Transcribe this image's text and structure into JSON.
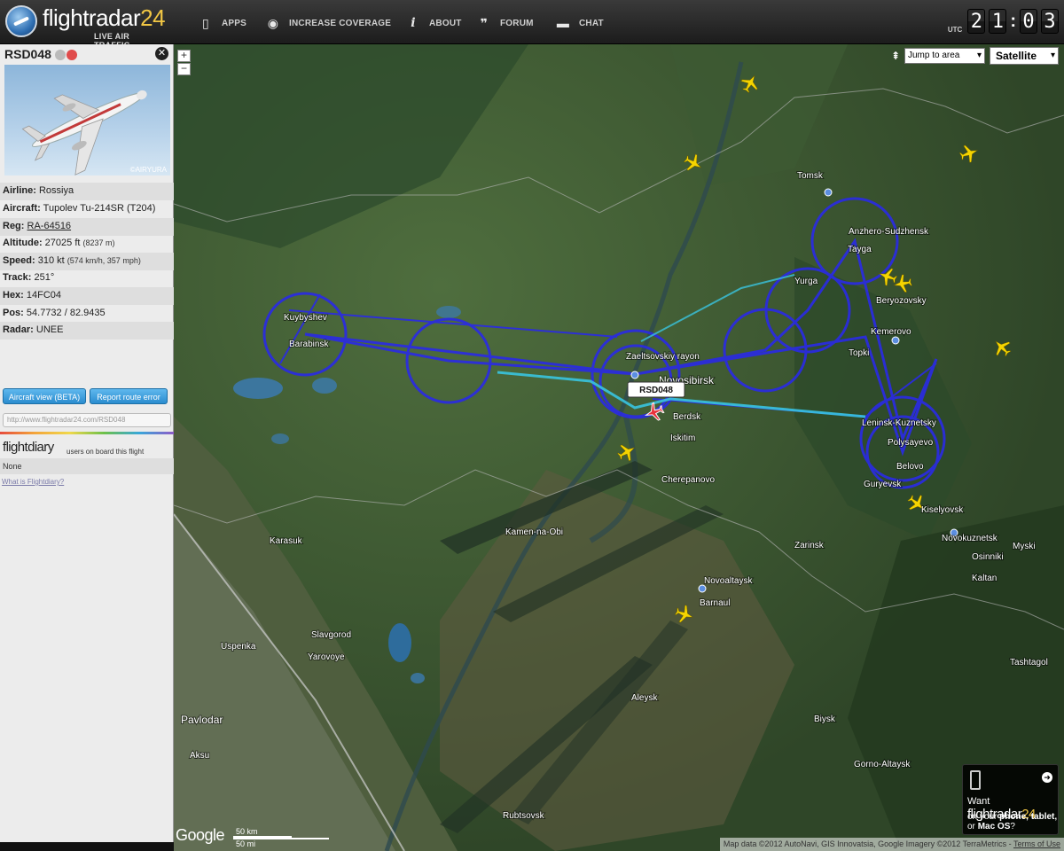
{
  "header": {
    "logo_main": "flightradar",
    "logo_num": "24",
    "logo_sub": "LIVE AIR TRAFFIC",
    "nav": [
      {
        "label": "APPS",
        "icon": "phone-icon"
      },
      {
        "label": "INCREASE COVERAGE",
        "icon": "eye-icon"
      },
      {
        "label": "ABOUT",
        "icon": "info-icon"
      },
      {
        "label": "FORUM",
        "icon": "quote-icon"
      },
      {
        "label": "CHAT",
        "icon": "chat-icon"
      }
    ],
    "clock": {
      "label": "UTC",
      "digits": [
        "2",
        "1",
        "0",
        "3"
      ]
    }
  },
  "sidebar": {
    "callsign": "RSD048",
    "photo_credit": "©AIRYURA",
    "fields": [
      {
        "label": "Airline:",
        "value": "Rossiya",
        "extra": ""
      },
      {
        "label": "Aircraft:",
        "value": "Tupolev Tu-214SR (T204)",
        "extra": ""
      },
      {
        "label": "Reg:",
        "value": "RA-64516",
        "extra": ""
      },
      {
        "label": "Altitude:",
        "value": "27025 ft",
        "extra": "(8237 m)"
      },
      {
        "label": "Speed:",
        "value": "310 kt",
        "extra": "(574 km/h, 357 mph)"
      },
      {
        "label": "Track:",
        "value": "251°",
        "extra": ""
      },
      {
        "label": "Hex:",
        "value": "14FC04",
        "extra": ""
      },
      {
        "label": "Pos:",
        "value": "54.7732 / 82.9435",
        "extra": ""
      },
      {
        "label": "Radar:",
        "value": "UNEE",
        "extra": ""
      }
    ],
    "buttons": {
      "aircraft_view": "Aircraft view (BETA)",
      "report_route": "Report route error"
    },
    "url": "http://www.flightradar24.com/RSD048",
    "flightdiary": {
      "logo": "flightdiary",
      "text": "users on board this flight",
      "none": "None",
      "link": "What is Flightdiary?"
    }
  },
  "map": {
    "jump_to": "Jump to area",
    "map_type": "Satellite",
    "zoom_in": "+",
    "zoom_out": "−",
    "flight_label": "RSD048",
    "places": [
      "Tomsk",
      "Anzhero-Sudzhensk",
      "Tayga",
      "Yurga",
      "Beryozovsky",
      "Kemerovo",
      "Topki",
      "Kuybyshev",
      "Barabinsk",
      "Zaeltsovskiy rayon",
      "Novosibirsk",
      "Berdsk",
      "Iskitim",
      "Leninsk-Kuznetsky",
      "Polysayevo",
      "Belovo",
      "Guryevsk",
      "Kiselyovsk",
      "Cherepanovo",
      "Karasuk",
      "Kamen-na-Obi",
      "Novokuznetsk",
      "Myski",
      "Osinniki",
      "Zarinsk",
      "Novoaltaysk",
      "Barnaul",
      "Kaltan",
      "Uspenka",
      "Slavgorod",
      "Yarovoye",
      "Pavlodar",
      "Aksu",
      "Aleysk",
      "Biysk",
      "Tashtagol",
      "Gorno-Altaysk",
      "Rubtsovsk"
    ],
    "google": "Google",
    "scale": {
      "km": "50 km",
      "mi": "50 mi"
    },
    "attribution": "Map data ©2012 AutoNavi, GIS Innovatsia, Google Imagery ©2012 TerraMetrics",
    "terms": "Terms of Use",
    "promo": {
      "want": "Want",
      "brand": "flightradar",
      "brand_num": "24",
      "line2": "on your",
      "phone": "phone,",
      "tablet": "tablet,",
      "or": "or",
      "mac": "Mac OS",
      "q": "?"
    },
    "colors": {
      "track": "#2a2ae6",
      "trail": "#39c4e0",
      "plane": "#f5d400",
      "selected": "#e8323c"
    }
  }
}
